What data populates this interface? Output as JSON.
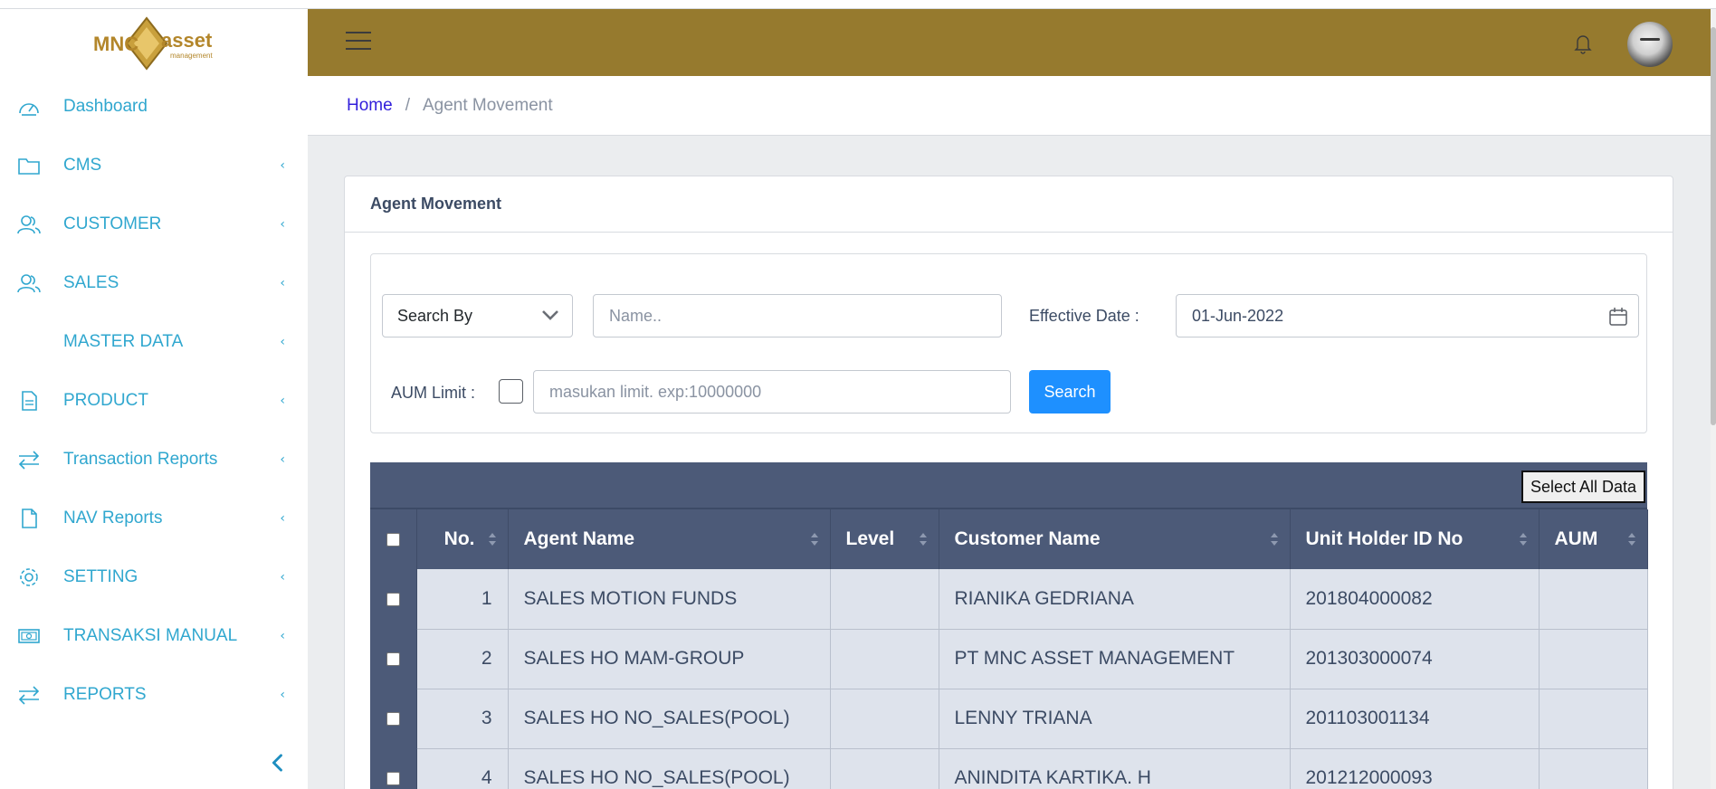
{
  "brand": {
    "logo_text_left": "MNC",
    "logo_text_right": "asset",
    "logo_sub": "management"
  },
  "sidebar": {
    "items": [
      {
        "label": "Dashboard",
        "icon": "speedometer-icon",
        "has_children": false
      },
      {
        "label": "CMS",
        "icon": "folder-icon",
        "has_children": true
      },
      {
        "label": "CUSTOMER",
        "icon": "people-icon",
        "has_children": true
      },
      {
        "label": "SALES",
        "icon": "people-icon",
        "has_children": true
      },
      {
        "label": "MASTER DATA",
        "icon": "",
        "has_children": true
      },
      {
        "label": "PRODUCT",
        "icon": "document-icon",
        "has_children": true
      },
      {
        "label": "Transaction Reports",
        "icon": "swap-arrows-icon",
        "has_children": true
      },
      {
        "label": "NAV Reports",
        "icon": "file-icon",
        "has_children": true
      },
      {
        "label": "SETTING",
        "icon": "gear-icon",
        "has_children": true
      },
      {
        "label": "TRANSAKSI MANUAL",
        "icon": "money-icon",
        "has_children": true
      },
      {
        "label": "REPORTS",
        "icon": "swap-arrows-icon",
        "has_children": true
      }
    ],
    "chevron": "‹"
  },
  "colors": {
    "header_bg": "#967a2e",
    "sidebar_text": "#30a7cf",
    "table_header_bg": "#4c5a78",
    "table_row_bg": "#dee3ec",
    "primary_button": "#1e90ff"
  },
  "breadcrumb": {
    "home": "Home",
    "separator": "/",
    "current": "Agent Movement"
  },
  "card": {
    "title": "Agent Movement",
    "filters": {
      "search_by": "Search By",
      "name_placeholder": "Name..",
      "effective_date_label": "Effective Date :",
      "effective_date_value": "01-Jun-2022",
      "aum_limit_label": "AUM Limit :",
      "aum_limit_placeholder": "masukan limit. exp:10000000",
      "search_button": "Search"
    }
  },
  "table": {
    "select_all_button": "Select All Data",
    "columns": [
      "No.",
      "Agent Name",
      "Level",
      "Customer Name",
      "Unit Holder ID No",
      "AUM"
    ],
    "rows": [
      {
        "no": "1",
        "agent_name": "SALES MOTION FUNDS",
        "level": "",
        "customer_name": "RIANIKA GEDRIANA",
        "unit_holder_id": "201804000082",
        "aum": ""
      },
      {
        "no": "2",
        "agent_name": "SALES HO MAM-GROUP",
        "level": "",
        "customer_name": "PT MNC ASSET MANAGEMENT",
        "unit_holder_id": "201303000074",
        "aum": ""
      },
      {
        "no": "3",
        "agent_name": "SALES HO NO_SALES(POOL)",
        "level": "",
        "customer_name": "LENNY TRIANA",
        "unit_holder_id": "201103001134",
        "aum": ""
      },
      {
        "no": "4",
        "agent_name": "SALES HO NO_SALES(POOL)",
        "level": "",
        "customer_name": "ANINDITA KARTIKA. H",
        "unit_holder_id": "201212000093",
        "aum": ""
      }
    ]
  }
}
